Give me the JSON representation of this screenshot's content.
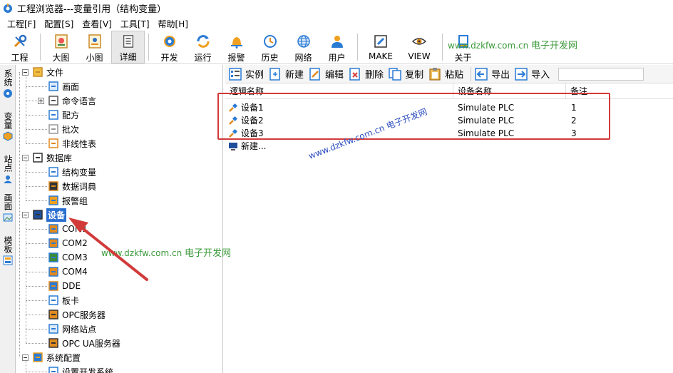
{
  "window": {
    "title": "工程浏览器---变量引用（结构变量）"
  },
  "menubar": {
    "items": [
      "工程[F]",
      "配置[S]",
      "查看[V]",
      "工具[T]",
      "帮助[H]"
    ]
  },
  "toolbar": {
    "items": [
      {
        "label": "工程",
        "icon": "wrench-icon"
      },
      {
        "label": "大图",
        "icon": "large-icons-icon"
      },
      {
        "label": "小图",
        "icon": "small-icons-icon"
      },
      {
        "label": "详细",
        "icon": "details-icon",
        "active": true
      },
      {
        "label": "开发",
        "icon": "develop-gear-icon"
      },
      {
        "label": "运行",
        "icon": "run-icon"
      },
      {
        "label": "报警",
        "icon": "alarm-bell-icon"
      },
      {
        "label": "历史",
        "icon": "history-clock-icon"
      },
      {
        "label": "网络",
        "icon": "network-globe-icon"
      },
      {
        "label": "用户",
        "icon": "user-icon"
      },
      {
        "label": "MAKE",
        "icon": "make-edit-icon"
      },
      {
        "label": "VIEW",
        "icon": "view-eye-icon"
      },
      {
        "label": "关于",
        "icon": "about-book-icon"
      }
    ]
  },
  "watermark": {
    "url": "www.dzkfw.com.cn",
    "site": "电子开发网"
  },
  "side_tabs": [
    "系统",
    "变量",
    "站点",
    "画面",
    "模板"
  ],
  "tree": {
    "nodes": [
      {
        "label": "文件",
        "level": 0,
        "icon": "folder-icon",
        "expander": "minus"
      },
      {
        "label": "画面",
        "level": 1,
        "icon": "screen-icon"
      },
      {
        "label": "命令语言",
        "level": 1,
        "icon": "command-icon",
        "expander": "plus"
      },
      {
        "label": "配方",
        "level": 1,
        "icon": "recipe-icon"
      },
      {
        "label": "批次",
        "level": 1,
        "icon": "batch-icon"
      },
      {
        "label": "非线性表",
        "level": 1,
        "icon": "nonlinear-table-icon"
      },
      {
        "label": "数据库",
        "level": 0,
        "icon": "database-icon",
        "expander": "minus"
      },
      {
        "label": "结构变量",
        "level": 1,
        "icon": "struct-variable-icon"
      },
      {
        "label": "数据词典",
        "level": 1,
        "icon": "data-dictionary-icon"
      },
      {
        "label": "报警组",
        "level": 1,
        "icon": "alarm-group-icon"
      },
      {
        "label": "设备",
        "level": 0,
        "icon": "device-monitor-icon",
        "expander": "minus",
        "selected": true
      },
      {
        "label": "COM1",
        "level": 1,
        "icon": "com-port-icon"
      },
      {
        "label": "COM2",
        "level": 1,
        "icon": "com-port-icon"
      },
      {
        "label": "COM3",
        "level": 1,
        "icon": "com-port-active-icon"
      },
      {
        "label": "COM4",
        "level": 1,
        "icon": "com-port-icon"
      },
      {
        "label": "DDE",
        "level": 1,
        "icon": "dde-icon"
      },
      {
        "label": "板卡",
        "level": 1,
        "icon": "board-card-icon"
      },
      {
        "label": "OPC服务器",
        "level": 1,
        "icon": "opc-server-icon"
      },
      {
        "label": "网络站点",
        "level": 1,
        "icon": "network-station-icon"
      },
      {
        "label": "OPC UA服务器",
        "level": 1,
        "icon": "opc-ua-server-icon"
      },
      {
        "label": "系统配置",
        "level": 0,
        "icon": "system-config-icon",
        "expander": "minus"
      },
      {
        "label": "设置开发系统",
        "level": 1,
        "icon": "dev-settings-icon"
      }
    ]
  },
  "right_toolbar": {
    "items": [
      {
        "label": "实例",
        "icon": "instance-icon"
      },
      {
        "label": "新建",
        "icon": "new-icon"
      },
      {
        "label": "编辑",
        "icon": "edit-icon"
      },
      {
        "label": "删除",
        "icon": "delete-icon"
      },
      {
        "label": "复制",
        "icon": "copy-icon"
      },
      {
        "label": "粘贴",
        "icon": "paste-icon"
      },
      {
        "label": "导出",
        "icon": "export-icon"
      },
      {
        "label": "导入",
        "icon": "import-icon"
      }
    ]
  },
  "device_list": {
    "columns": [
      "逻辑名称",
      "设备名称",
      "备注"
    ],
    "rows": [
      {
        "name": "设备1",
        "device": "Simulate PLC",
        "note": "1"
      },
      {
        "name": "设备2",
        "device": "Simulate PLC",
        "note": "2"
      },
      {
        "name": "设备3",
        "device": "Simulate PLC",
        "note": "3"
      }
    ],
    "new_item": "新建..."
  },
  "colors": {
    "selection": "#2b6fd0",
    "annotation_red": "#d23a3a",
    "watermark_green": "#3b9a3b"
  }
}
